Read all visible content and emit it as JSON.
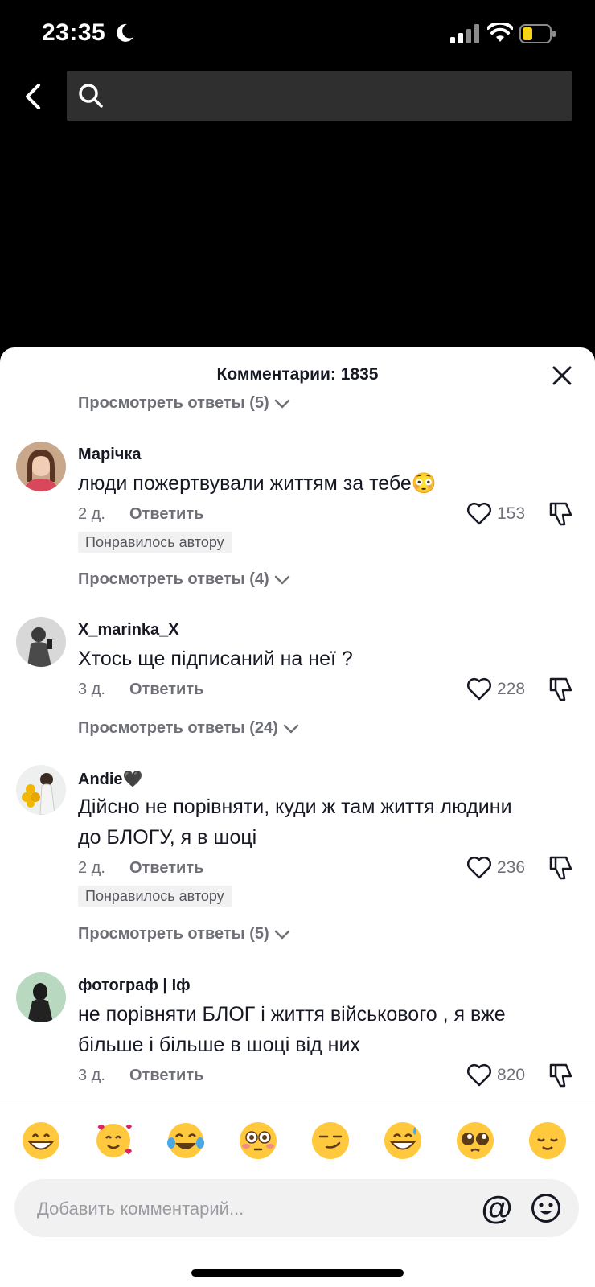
{
  "status_bar": {
    "time": "23:35",
    "icons": [
      "moon-icon",
      "signal-icon",
      "wifi-icon",
      "battery-icon"
    ]
  },
  "search": {
    "placeholder": "",
    "value": ""
  },
  "comments_sheet": {
    "title": "Комментарии: 1835",
    "top_view_replies": "Просмотреть ответы (5)",
    "comments": [
      {
        "username": "Марічка",
        "text_lines": [
          "люди пожертвували життям за тебе😳"
        ],
        "age": "2 д.",
        "reply_label": "Ответить",
        "likes": "153",
        "badge": "Понравилось автору",
        "view_replies": "Просмотреть ответы (4)"
      },
      {
        "username": "X_marinka_X",
        "text_lines": [
          "Хтось ще підписаний на неї ?"
        ],
        "age": "3 д.",
        "reply_label": "Ответить",
        "likes": "228",
        "badge": "",
        "view_replies": "Просмотреть ответы (24)"
      },
      {
        "username": "Andie🖤",
        "text_lines": [
          "Дійсно не порівняти, куди ж там життя людини",
          "до БЛОГУ, я в шоці"
        ],
        "age": "2 д.",
        "reply_label": "Ответить",
        "likes": "236",
        "badge": "Понравилось автору",
        "view_replies": "Просмотреть ответы (5)"
      },
      {
        "username": "фотограф | Іф",
        "text_lines": [
          "не порівняти БЛОГ і життя військового , я вже",
          "більше і більше в шоці від них"
        ],
        "age": "3 д.",
        "reply_label": "Ответить",
        "likes": "820",
        "badge": "",
        "view_replies": ""
      }
    ]
  },
  "emoji_bar": [
    "😁",
    "🥰",
    "😂",
    "😳",
    "😏",
    "😅",
    "🥺",
    "😌"
  ],
  "comment_input": {
    "placeholder": "Добавить комментарий...",
    "at_symbol": "@"
  },
  "colors": {
    "accent_text": "#161823",
    "muted_text": "#6f7077",
    "input_bg": "#f1f1f2"
  }
}
